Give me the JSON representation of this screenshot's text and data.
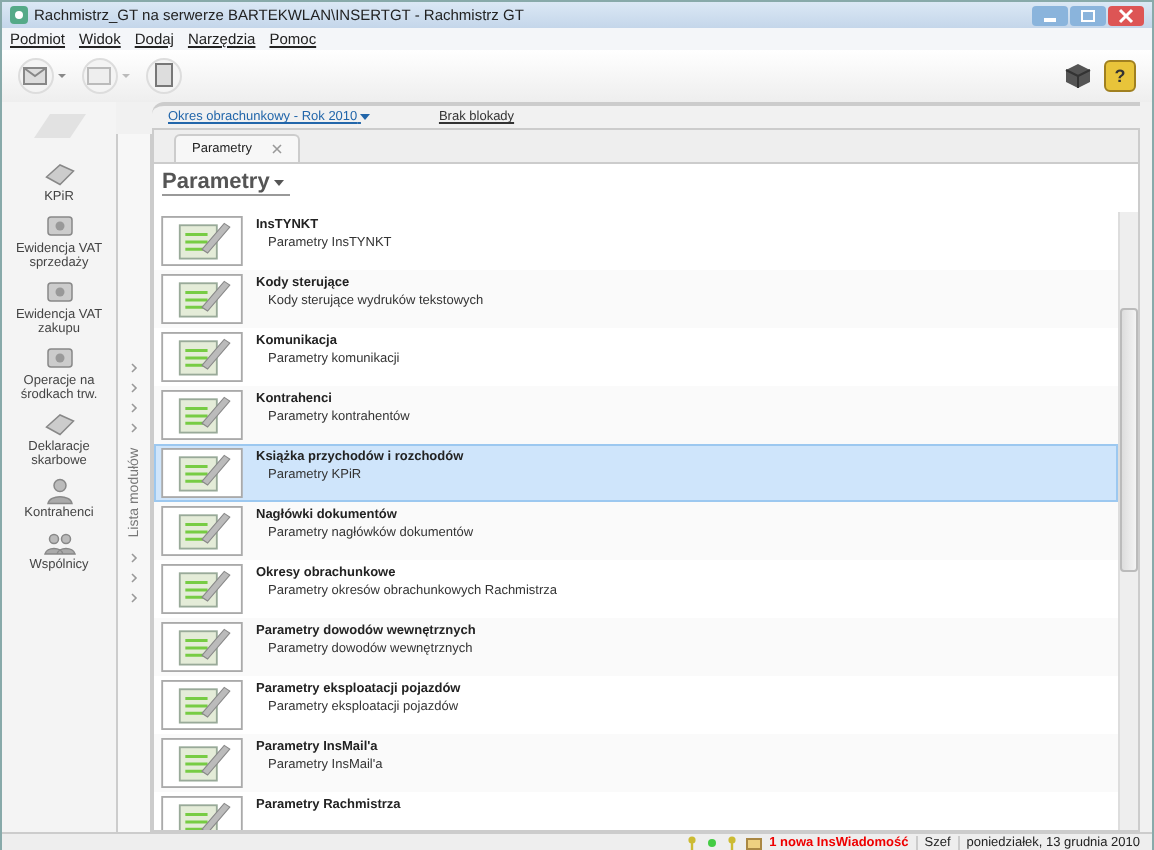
{
  "window": {
    "title": "Rachmistrz_GT na serwerze BARTEKWLAN\\INSERTGT - Rachmistrz GT"
  },
  "menu": [
    "Podmiot",
    "Widok",
    "Dodaj",
    "Narzędzia",
    "Pomoc"
  ],
  "toolbar": {
    "help_label": "?"
  },
  "sidebar": {
    "items": [
      {
        "label": "KPiR",
        "kind": "book"
      },
      {
        "label": "Ewidencja VAT sprzedaży",
        "kind": "register"
      },
      {
        "label": "Ewidencja VAT zakupu",
        "kind": "register"
      },
      {
        "label": "Operacje na środkach trw.",
        "kind": "register"
      },
      {
        "label": "Deklaracje skarbowe",
        "kind": "book"
      },
      {
        "label": "Kontrahenci",
        "kind": "person"
      },
      {
        "label": "Wspólnicy",
        "kind": "people"
      }
    ],
    "strip_label": "Lista modułów"
  },
  "header": {
    "period_link": "Okres obrachunkowy - Rok 2010",
    "lock_status": "Brak blokady"
  },
  "tabs": [
    {
      "label": "Parametry",
      "selected": true
    }
  ],
  "heading": "Parametry",
  "rows": [
    {
      "title": "InsTYNKT",
      "description": "Parametry InsTYNKT",
      "selected": false
    },
    {
      "title": "Kody sterujące",
      "description": "Kody sterujące wydruków tekstowych",
      "selected": false
    },
    {
      "title": "Komunikacja",
      "description": "Parametry komunikacji",
      "selected": false
    },
    {
      "title": "Kontrahenci",
      "description": "Parametry kontrahentów",
      "selected": false
    },
    {
      "title": "Książka przychodów i rozchodów",
      "description": "Parametry KPiR",
      "selected": true
    },
    {
      "title": "Nagłówki dokumentów",
      "description": "Parametry nagłówków dokumentów",
      "selected": false
    },
    {
      "title": "Okresy obrachunkowe",
      "description": "Parametry okresów obrachunkowych Rachmistrza",
      "selected": false
    },
    {
      "title": "Parametry dowodów wewnętrznych",
      "description": "Parametry dowodów wewnętrznych",
      "selected": false
    },
    {
      "title": "Parametry eksploatacji pojazdów",
      "description": "Parametry eksploatacji pojazdów",
      "selected": false
    },
    {
      "title": "Parametry InsMail'a",
      "description": "Parametry InsMail'a",
      "selected": false
    },
    {
      "title": "Parametry Rachmistrza",
      "selected": false
    }
  ],
  "status_bar": {
    "message": "1 nowa InsWiadomość",
    "user": "Szef",
    "date": "poniedziałek, 13 grudnia 2010"
  }
}
